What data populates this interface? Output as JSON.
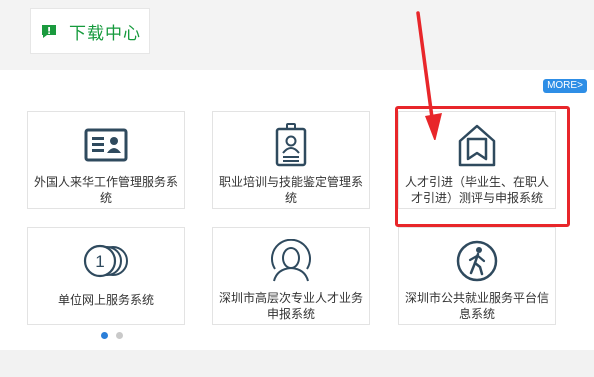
{
  "section": {
    "title": "下载中心",
    "icon": "chat-bubble-icon"
  },
  "more_label": "MORE>",
  "colors": {
    "title_green": "#159a3c",
    "more_blue": "#2e8ee6",
    "icon_blue": "#2f4a5e",
    "highlight_red": "#e8262a"
  },
  "cards": [
    {
      "label": "外国人来华工作管理服务系统",
      "icon": "id-card-icon"
    },
    {
      "label": "职业培训与技能鉴定管理系统",
      "icon": "badge-icon"
    },
    {
      "label": "人才引进（毕业生、在职人才引进）测评与申报系统",
      "icon": "house-bookmark-icon"
    },
    {
      "label": "单位网上服务系统",
      "icon": "coins-icon"
    },
    {
      "label": "深圳市高层次专业人才业务申报系统",
      "icon": "person-icon"
    },
    {
      "label": "深圳市公共就业服务平台信息系统",
      "icon": "walking-person-icon"
    }
  ],
  "carousel": {
    "page_count": 2,
    "active_index": 0
  }
}
